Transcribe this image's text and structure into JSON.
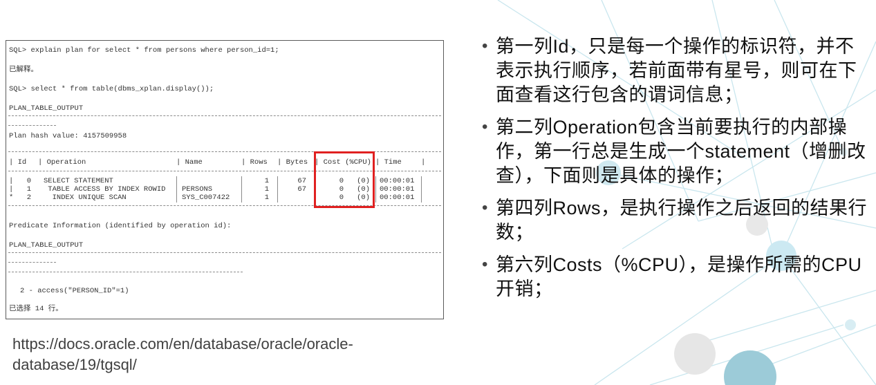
{
  "console": {
    "lines": [
      "SQL> explain plan for select * from persons where person_id=1;",
      "已解释。",
      "SQL> select * from table(dbms_xplan.display());",
      "PLAN_TABLE_OUTPUT",
      "Plan hash value: 4157509958",
      "Predicate Information (identified by operation id):",
      "PLAN_TABLE_OUTPUT",
      "2 - access(\"PERSON_ID\"=1)",
      "已选择 14 行。"
    ],
    "plan_headers": [
      "Id",
      "Operation",
      "Name",
      "Rows",
      "Bytes",
      "Cost (%CPU)",
      "Time"
    ],
    "plan_rows": [
      {
        "marker": "",
        "id": "0",
        "operation": "SELECT STATEMENT",
        "name": "",
        "rows": "1",
        "bytes": "67",
        "cost": "0",
        "cpu": "(0)",
        "time": "00:00:01"
      },
      {
        "marker": "",
        "id": "1",
        "operation": " TABLE ACCESS BY INDEX ROWID",
        "name": "PERSONS",
        "rows": "1",
        "bytes": "67",
        "cost": "0",
        "cpu": "(0)",
        "time": "00:00:01"
      },
      {
        "marker": "*",
        "id": "2",
        "operation": "  INDEX UNIQUE SCAN",
        "name": "SYS_C007422",
        "rows": "1",
        "bytes": "",
        "cost": "0",
        "cpu": "(0)",
        "time": "00:00:01"
      }
    ],
    "highlight_color": "#e02020"
  },
  "reference_url": "https://docs.oracle.com/en/database/oracle/oracle-database/19/tgsql/",
  "bullets": [
    {
      "glyph": "•",
      "text": "第一列Id，只是每一个操作的标识符，并不表示执行顺序，若前面带有星号，则可在下面查看这行包含的谓词信息；"
    },
    {
      "glyph": "•",
      "text": "第二列Operation包含当前要执行的内部操作，第一行总是生成一个statement（增删改查），下面则是具体的操作；"
    },
    {
      "glyph": "•",
      "text": "第四列Rows，是执行操作之后返回的结果行数；"
    },
    {
      "glyph": "•",
      "text": "第六列Costs（%CPU），是操作所需的CPU开销；"
    }
  ]
}
